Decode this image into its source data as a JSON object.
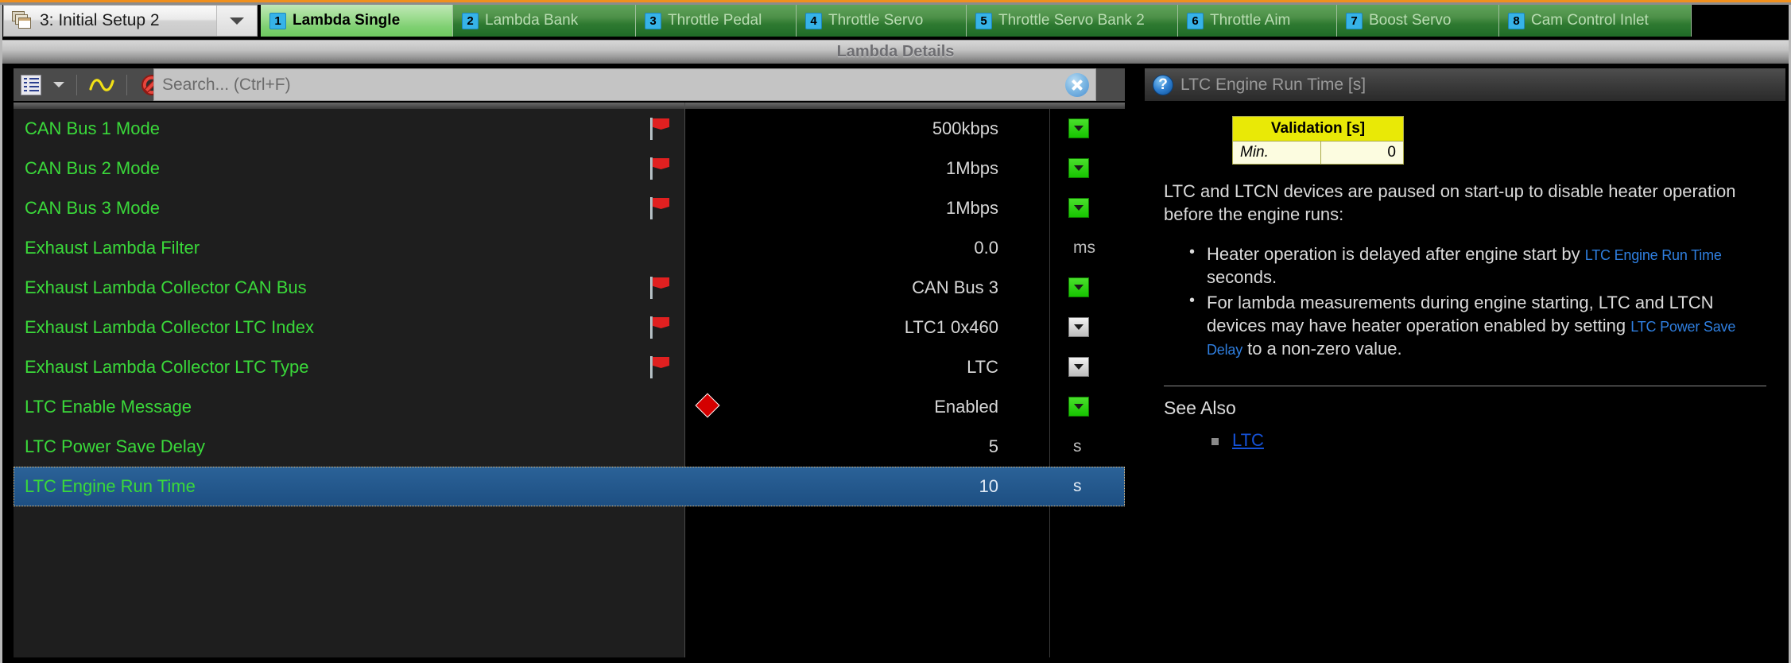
{
  "project_selector": {
    "label": "3: Initial Setup 2",
    "icon": "windows-stack-icon",
    "dropdown_icon": "chevron-down-icon"
  },
  "tabs": [
    {
      "num": "1",
      "label": "Lambda Single",
      "active": true
    },
    {
      "num": "2",
      "label": "Lambda Bank",
      "active": false
    },
    {
      "num": "3",
      "label": "Throttle Pedal",
      "active": false
    },
    {
      "num": "4",
      "label": "Throttle Servo",
      "active": false
    },
    {
      "num": "5",
      "label": "Throttle Servo Bank 2",
      "active": false
    },
    {
      "num": "6",
      "label": "Throttle Aim",
      "active": false
    },
    {
      "num": "7",
      "label": "Boost Servo",
      "active": false
    },
    {
      "num": "8",
      "label": "Cam Control Inlet",
      "active": false
    }
  ],
  "panel": {
    "title": "Lambda Details"
  },
  "toolbar": {
    "list_icon": "list-view-icon",
    "list_caret_icon": "chevron-down-icon",
    "wave_icon": "sine-wave-icon",
    "noentry_icon": "no-entry-icon",
    "notequal_icon": "not-equal-icon",
    "notequal_glyph": "≠"
  },
  "search": {
    "placeholder": "Search... (Ctrl+F)",
    "value": "",
    "clear_icon": "clear-circle-x-icon"
  },
  "parameters": [
    {
      "name": "CAN Bus 1 Mode",
      "flag": true,
      "diamond": false,
      "value": "500kbps",
      "unit": "",
      "dropdown": "green",
      "selected": false
    },
    {
      "name": "CAN Bus 2 Mode",
      "flag": true,
      "diamond": false,
      "value": "1Mbps",
      "unit": "",
      "dropdown": "green",
      "selected": false
    },
    {
      "name": "CAN Bus 3 Mode",
      "flag": true,
      "diamond": false,
      "value": "1Mbps",
      "unit": "",
      "dropdown": "green",
      "selected": false
    },
    {
      "name": "Exhaust Lambda Filter",
      "flag": false,
      "diamond": false,
      "value": "0.0",
      "unit": "ms",
      "dropdown": "",
      "selected": false
    },
    {
      "name": "Exhaust Lambda Collector CAN Bus",
      "flag": true,
      "diamond": false,
      "value": "CAN Bus 3",
      "unit": "",
      "dropdown": "green",
      "selected": false
    },
    {
      "name": "Exhaust Lambda Collector LTC Index",
      "flag": true,
      "diamond": false,
      "value": "LTC1 0x460",
      "unit": "",
      "dropdown": "grey",
      "selected": false
    },
    {
      "name": "Exhaust Lambda Collector LTC Type",
      "flag": true,
      "diamond": false,
      "value": "LTC",
      "unit": "",
      "dropdown": "grey",
      "selected": false
    },
    {
      "name": "LTC Enable Message",
      "flag": false,
      "diamond": true,
      "value": "Enabled",
      "unit": "",
      "dropdown": "green",
      "selected": false
    },
    {
      "name": "LTC Power Save Delay",
      "flag": false,
      "diamond": false,
      "value": "5",
      "unit": "s",
      "dropdown": "",
      "selected": false
    },
    {
      "name": "LTC Engine Run Time",
      "flag": false,
      "diamond": false,
      "value": "10",
      "unit": "s",
      "dropdown": "",
      "selected": true
    }
  ],
  "help": {
    "header_icon": "help-question-icon",
    "header_title": "LTC Engine Run Time [s]",
    "validation": {
      "header": "Validation [s]",
      "rows": [
        {
          "key": "Min.",
          "value": "0"
        }
      ]
    },
    "intro": "LTC and LTCN devices are paused on start-up to disable heater operation before the engine runs:",
    "bullets": [
      {
        "part1": "Heater operation is delayed after engine start by ",
        "link": "LTC Engine Run Time",
        "part2": " seconds."
      },
      {
        "part1": "For lambda measurements during engine starting, LTC and LTCN devices may have heater operation enabled by setting ",
        "link": "LTC Power Save Delay",
        "part2": " to a non-zero value."
      }
    ],
    "see_also_title": "See Also",
    "see_also_links": [
      {
        "label": "LTC"
      }
    ]
  },
  "colors": {
    "accent_orange": "#f0901e",
    "tab_active": "#9ddc90",
    "tab_inactive": "#2f7a31",
    "param_name_green": "#3ad93a",
    "selection_blue": "#2b6298",
    "link_blue": "#2f7fe0",
    "validation_yellow": "#e9e906"
  }
}
